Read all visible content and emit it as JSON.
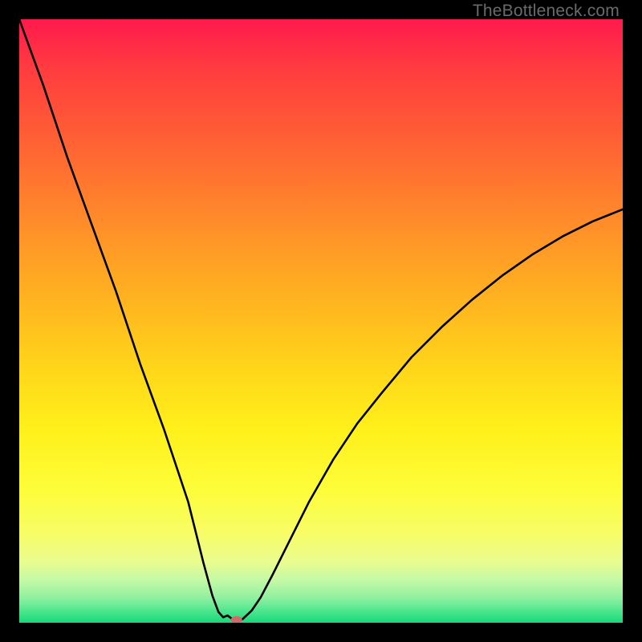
{
  "watermark": "TheBottleneck.com",
  "chart_data": {
    "type": "line",
    "title": "",
    "xlabel": "",
    "ylabel": "",
    "xlim": [
      0,
      100
    ],
    "ylim": [
      0,
      100
    ],
    "grid": false,
    "series": [
      {
        "name": "bottleneck-curve",
        "x": [
          0,
          4,
          8,
          12,
          16,
          20,
          24,
          28,
          30.5,
          32,
          33,
          33.8,
          34.5,
          36,
          37,
          38.5,
          40,
          42,
          45,
          48,
          52,
          56,
          60,
          65,
          70,
          75,
          80,
          85,
          90,
          95,
          100
        ],
        "values": [
          100,
          89,
          77,
          66,
          55,
          43,
          32,
          20,
          10,
          4.5,
          1.8,
          0.9,
          1.2,
          0.1,
          0.6,
          2.0,
          4.2,
          8,
          14,
          20,
          27,
          33,
          38,
          44,
          49,
          53.5,
          57.5,
          61,
          64,
          66.5,
          68.5
        ]
      }
    ],
    "markers": [
      {
        "name": "minimum-marker",
        "x": 36.0,
        "y": 0.5
      }
    ],
    "colors": {
      "curve": "#000000",
      "marker": "#d06a6a",
      "gradient_top": "#ff1a4d",
      "gradient_bottom": "#18d87a"
    }
  }
}
